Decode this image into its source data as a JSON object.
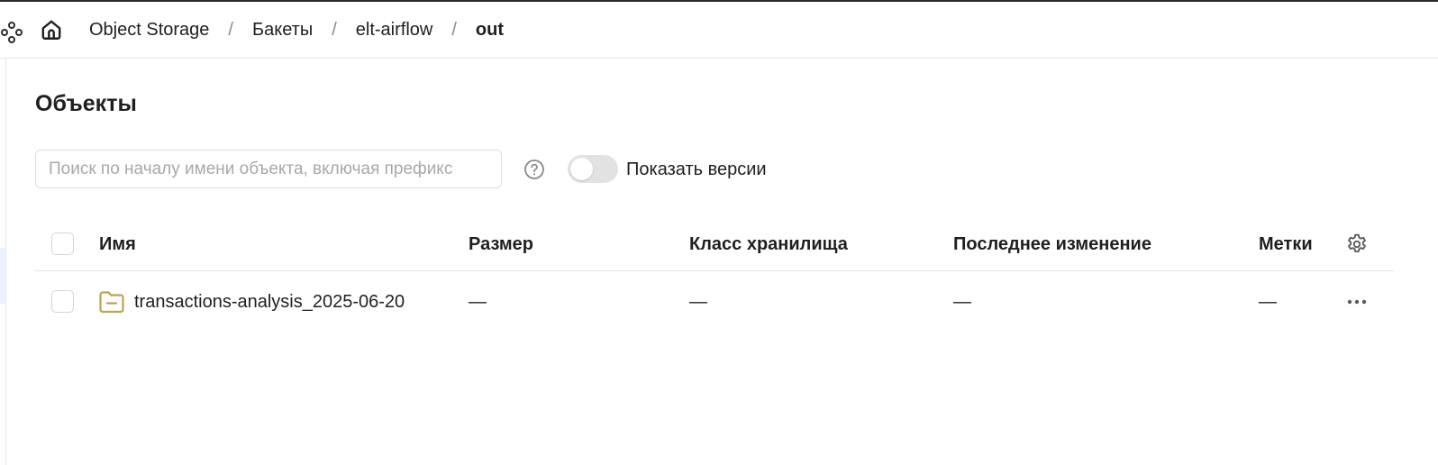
{
  "header": {
    "services_icon": "services-grid-icon",
    "home_icon": "home-icon",
    "breadcrumb": [
      {
        "label": "Object Storage"
      },
      {
        "label": "Бакеты"
      },
      {
        "label": "elt-airflow"
      },
      {
        "label": "out"
      }
    ],
    "separator": "/"
  },
  "main": {
    "title": "Объекты",
    "search": {
      "value": "",
      "placeholder": "Поиск по началу имени объекта, включая префикс"
    },
    "help_icon": "question-circle-icon",
    "versions_toggle": {
      "label": "Показать версии",
      "checked": false
    }
  },
  "table": {
    "columns": {
      "name": "Имя",
      "size": "Размер",
      "storage_class": "Класс хранилища",
      "modified": "Последнее изменение",
      "labels": "Метки"
    },
    "settings_icon": "gear-icon",
    "rows": [
      {
        "type": "folder",
        "icon": "folder-icon",
        "name": "transactions-analysis_2025-06-20",
        "size": "—",
        "storage_class": "—",
        "modified": "—",
        "labels": "—",
        "actions_icon": "more-horizontal-icon"
      }
    ]
  },
  "colors": {
    "folder": "#b9a451",
    "accent_rail": "#eef0fb",
    "border": "#e6e6e6",
    "toggle_off": "#e2e2e2",
    "text": "#1f1f1f",
    "placeholder": "#a8a8a8"
  }
}
